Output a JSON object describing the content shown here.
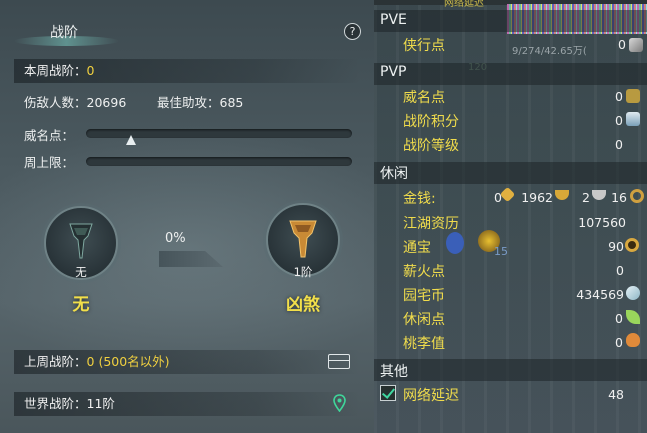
{
  "top_partial_text": "网络延迟",
  "left": {
    "title": "战阶",
    "help_label": "?",
    "weekly_rank_label": "本周战阶：",
    "weekly_rank_value": "0",
    "enemies_label": "伤敌人数：",
    "enemies_value": "20696",
    "assist_label": "最佳助攻：",
    "assist_value": "685",
    "prestige_label": "威名点：",
    "prestige_progress": 0.17,
    "weekly_cap_label": "周上限：",
    "weekly_cap_progress": 0,
    "current_badge": {
      "level": "无",
      "name": "无"
    },
    "progress_percent": "0%",
    "next_badge": {
      "level": "1阶",
      "name": "凶煞"
    },
    "last_week_label": "上周战阶：",
    "last_week_value": "0 (500名以外)",
    "world_rank_label": "世界战阶：",
    "world_rank_value": "11阶"
  },
  "right": {
    "sections": {
      "pve": "PVE",
      "pvp": "PVP",
      "leisure": "休闲",
      "other": "其他"
    },
    "pve_items": [
      {
        "label": "侠行点",
        "value": "0"
      }
    ],
    "pvp_items": [
      {
        "label": "威名点",
        "value": "0"
      },
      {
        "label": "战阶积分",
        "value": "0"
      },
      {
        "label": "战阶等级",
        "value": "0"
      }
    ],
    "money": {
      "label": "金钱:",
      "gold_a": "0",
      "gold_b": "1962",
      "silver": "2",
      "copper": "16"
    },
    "leisure_items": [
      {
        "label": "江湖资历",
        "value": "107560"
      },
      {
        "label": "通宝",
        "value": "90"
      },
      {
        "label": "薪火点",
        "value": "0"
      },
      {
        "label": "园宅币",
        "value": "434569"
      },
      {
        "label": "休闲点",
        "value": "0"
      },
      {
        "label": "桃李值",
        "value": "0"
      }
    ],
    "other_items": [
      {
        "label": "网络延迟",
        "value": "48",
        "checked": true
      }
    ],
    "bg_text_1": "9/274/42.65万(",
    "bg_text_2": "120",
    "bg_text_3": "15"
  },
  "colors": {
    "accent_yellow": "#f0d040",
    "label_text": "#eef0f0"
  }
}
